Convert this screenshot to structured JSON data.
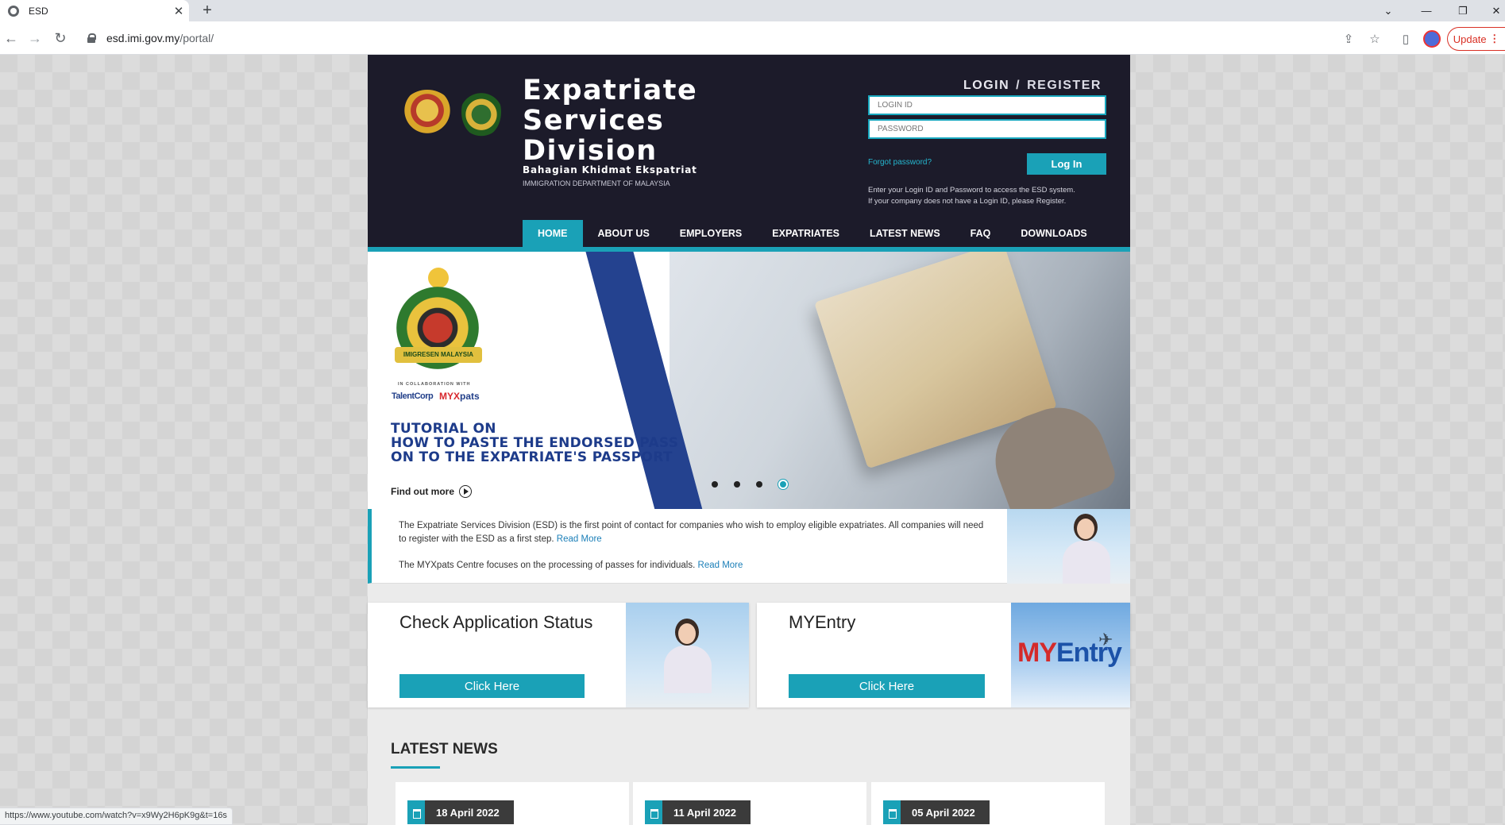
{
  "browser": {
    "tab_title": "ESD",
    "tab_close": "✕",
    "new_tab": "+",
    "url_host": "esd.imi.gov.my",
    "url_path": "/portal/",
    "update_label": "Update",
    "status_url": "https://www.youtube.com/watch?v=x9Wy2H6pK9g&t=16s"
  },
  "header": {
    "title_lines": [
      "Expatriate",
      "Services",
      "Division"
    ],
    "subtitle": "Bahagian Khidmat Ekspatriat",
    "department": "IMMIGRATION DEPARTMENT OF MALAYSIA"
  },
  "login": {
    "login_tab": "LOGIN",
    "separator": "/",
    "register_tab": "REGISTER",
    "login_id_placeholder": "LOGIN ID",
    "password_placeholder": "PASSWORD",
    "forgot": "Forgot password?",
    "button": "Log In",
    "info_line1": "Enter your Login ID and Password to access the ESD system.",
    "info_line2": "If your company does not have a Login ID, please Register."
  },
  "nav": {
    "items": [
      {
        "label": "HOME",
        "active": true
      },
      {
        "label": "ABOUT US"
      },
      {
        "label": "EMPLOYERS"
      },
      {
        "label": "EXPATRIATES"
      },
      {
        "label": "LATEST NEWS"
      },
      {
        "label": "FAQ"
      },
      {
        "label": "DOWNLOADS"
      }
    ]
  },
  "banner": {
    "crest_ribbon": "IMIGRESEN MALAYSIA",
    "collab_label": "IN COLLABORATION WITH",
    "partner1": "TalentCorp",
    "partner2_a": "MYX",
    "partner2_b": "pats",
    "heading_lines": [
      "TUTORIAL ON",
      "HOW TO PASTE THE ENDORSED PASS",
      "ON TO THE EXPATRIATE'S PASSPORT"
    ],
    "cta": "Find out more",
    "slide_count": 4,
    "active_slide": 4
  },
  "intro": {
    "para1": "The Expatriate Services Division (ESD) is the first point of contact for companies who wish to employ eligible expatriates. All companies will need to register with the ESD as a first step.",
    "para1_link": "Read More",
    "para2": "The MYXpats Centre focuses on the processing of passes for individuals.",
    "para2_link": "Read More"
  },
  "cards": [
    {
      "title": "Check Application Status",
      "button": "Click Here"
    },
    {
      "title": "MYEntry",
      "button": "Click Here",
      "logo_a": "MY",
      "logo_b": "Entry"
    }
  ],
  "news": {
    "title": "LATEST NEWS",
    "items": [
      {
        "date": "18 April 2022"
      },
      {
        "date": "11 April 2022"
      },
      {
        "date": "05 April 2022"
      }
    ]
  },
  "colors": {
    "header_bg": "#1c1b2a",
    "accent": "#1aa1b7",
    "banner_heading": "#1d3b8a"
  }
}
